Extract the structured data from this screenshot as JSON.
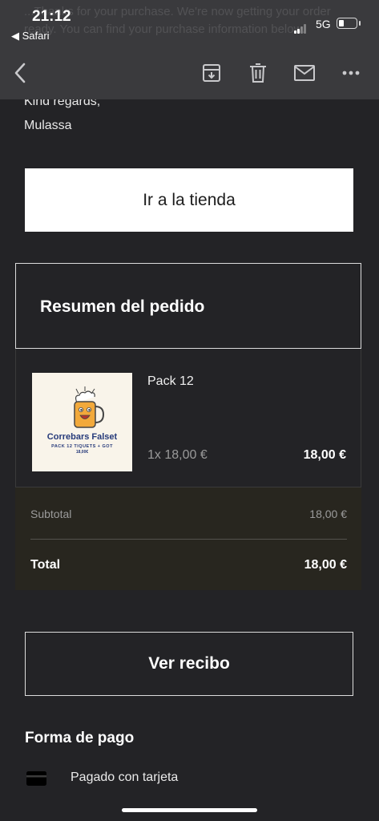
{
  "status": {
    "time": "21:12",
    "back_app": "◀ Safari",
    "network": "5G"
  },
  "email": {
    "background_text": "...Thanks for your purchase. We're now getting your order ready. You can find your purchase information below.",
    "signoff": "Kind regards,",
    "sender": "Mulassa",
    "store_button": "Ir a la tienda"
  },
  "order": {
    "summary_title": "Resumen del pedido",
    "item": {
      "name": "Pack 12",
      "quantity": "1x 18,00 €",
      "price": "18,00 €",
      "image_brand": "Correbars Falset",
      "image_subtitle": "PACK 12 TIQUETS + GOT",
      "image_price": "18,00€"
    },
    "subtotal_label": "Subtotal",
    "subtotal_value": "18,00 €",
    "total_label": "Total",
    "total_value": "18,00 €"
  },
  "receipt_button": "Ver recibo",
  "payment": {
    "title": "Forma de pago",
    "method": "Pagado con tarjeta"
  },
  "toolbar": {
    "icons": [
      "chevron-left-icon",
      "archive-icon",
      "trash-icon",
      "mail-icon",
      "more-icon"
    ]
  },
  "colors": {
    "background": "#232326",
    "bar": "#3a3a3d",
    "totals_background": "#28261f",
    "thumb_brand": "#263a7a",
    "beer": "#f2a93b"
  }
}
